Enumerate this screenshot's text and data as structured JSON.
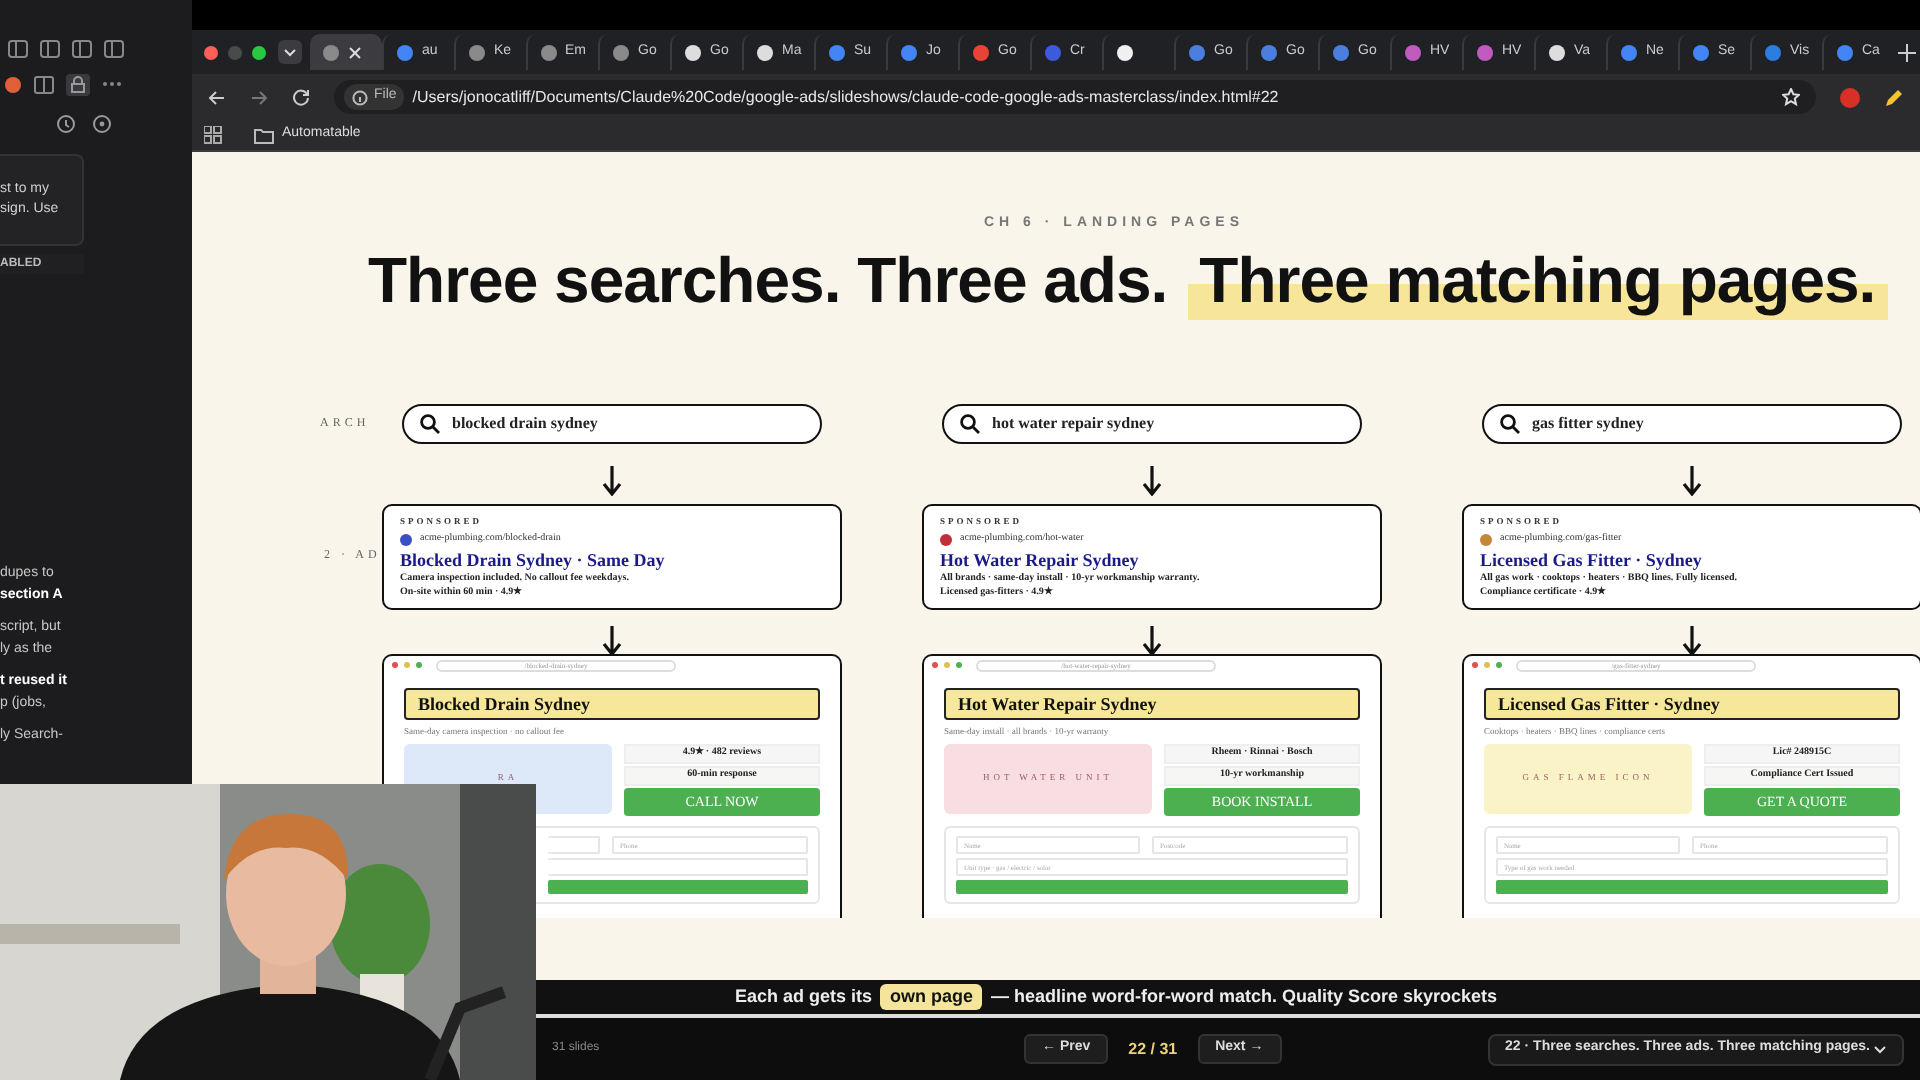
{
  "sidebar": {
    "lines_top": [
      "st to my",
      "sign. Use"
    ],
    "badge": "ABLED",
    "lines_bottom": [
      "dupes to",
      "section A",
      "script, but",
      "ly as the",
      "t reused it",
      "p (jobs,",
      "ly Search-"
    ]
  },
  "browser": {
    "tabs": [
      {
        "selected": true
      },
      {
        "label": "au",
        "selected": false
      },
      {
        "label": "Ke",
        "selected": false
      },
      {
        "label": "Em",
        "selected": false
      },
      {
        "label": "Go",
        "selected": false
      },
      {
        "label": "Go",
        "selected": false
      },
      {
        "label": "Ma",
        "selected": false
      },
      {
        "label": "Su",
        "selected": false
      },
      {
        "label": "Jo",
        "selected": false
      },
      {
        "label": "Go",
        "selected": false
      },
      {
        "label": "Cr",
        "selected": false
      },
      {
        "selected": false
      },
      {
        "label": "Go",
        "selected": false
      },
      {
        "label": "Go",
        "selected": false
      },
      {
        "label": "Go",
        "selected": false
      },
      {
        "label": "HV",
        "selected": false
      },
      {
        "label": "HV",
        "selected": false
      },
      {
        "label": "Va",
        "selected": false
      },
      {
        "label": "Ne",
        "selected": false
      },
      {
        "label": "Se",
        "selected": false
      },
      {
        "label": "Vis",
        "selected": false
      },
      {
        "label": "Ca",
        "selected": false
      }
    ],
    "scheme": "File",
    "url": "/Users/jonocatliff/Documents/Claude%20Code/google-ads/slideshows/claude-code-google-ads-masterclass/index.html#22",
    "bookmark": "Automatable"
  },
  "slide": {
    "eyebrow": "CH 6 · LANDING PAGES",
    "title": "Three searches. Three ads.",
    "title_highlight": "Three matching pages.",
    "row_labels": [
      "ARCH",
      "2 · AD"
    ],
    "columns": [
      {
        "query": "blocked drain sydney",
        "ad": {
          "sponsored": "SPONSORED",
          "url": "acme-plumbing.com/blocked-drain",
          "color": "#3b4fc4",
          "title": "Blocked Drain Sydney · Same Day",
          "text": "Camera inspection included. No callout fee weekdays.",
          "text_2": "On-site within 60 min · 4.9★"
        },
        "page_url": "/blocked-drain-sydney",
        "headline": "Blocked Drain Sydney",
        "subline": "Same-day camera inspection · no callout fee",
        "hero": {
          "label": "RA",
          "color": "#dde8f8"
        },
        "facts": [
          "4.9★ · 482 reviews",
          "60-min response"
        ],
        "cta": "CALL NOW",
        "fields": [
          "Phone"
        ]
      },
      {
        "query": "hot water repair sydney",
        "ad": {
          "sponsored": "SPONSORED",
          "url": "acme-plumbing.com/hot-water",
          "color": "#c0303a",
          "title": "Hot Water Repair Sydney",
          "text": "All brands · same-day install · 10-yr workmanship warranty.",
          "text_2": "Licensed gas-fitters · 4.9★"
        },
        "page_url": "/hot-water-repair-sydney",
        "headline": "Hot Water Repair Sydney",
        "subline": "Same-day install · all brands · 10-yr warranty",
        "hero": {
          "label": "HOT WATER UNIT",
          "color": "#f8dde2"
        },
        "facts": [
          "Rheem · Rinnai · Bosch",
          "10-yr workmanship"
        ],
        "cta": "BOOK INSTALL",
        "fields": [
          "Name",
          "Postcode",
          "Unit type · gas / electric / solar"
        ]
      },
      {
        "query": "gas fitter sydney",
        "ad": {
          "sponsored": "SPONSORED",
          "url": "acme-plumbing.com/gas-fitter",
          "color": "#c8863a",
          "title": "Licensed Gas Fitter · Sydney",
          "text": "All gas work · cooktops · heaters · BBQ lines. Fully licensed.",
          "text_2": "Compliance certificate · 4.9★"
        },
        "page_url": "/gas-fitter-sydney",
        "headline": "Licensed Gas Fitter · Sydney",
        "subline": "Cooktops · heaters · BBQ lines · compliance certs",
        "hero": {
          "label": "GAS FLAME ICON",
          "color": "#faf3c8"
        },
        "facts": [
          "Lic# 248915C",
          "Compliance Cert Issued"
        ],
        "cta": "GET A QUOTE",
        "fields": [
          "Name",
          "Phone",
          "Type of gas work needed"
        ]
      }
    ],
    "caption": "Each ad gets its",
    "caption_highlight": "own page",
    "caption_after": "— headline word-for-word match. Quality Score skyrockets"
  },
  "nav": {
    "count": "31 slides",
    "prev": "← Prev",
    "position": "22 / 31",
    "next": "Next →",
    "current": "22 · Three searches. Three ads. Three matching pages."
  }
}
